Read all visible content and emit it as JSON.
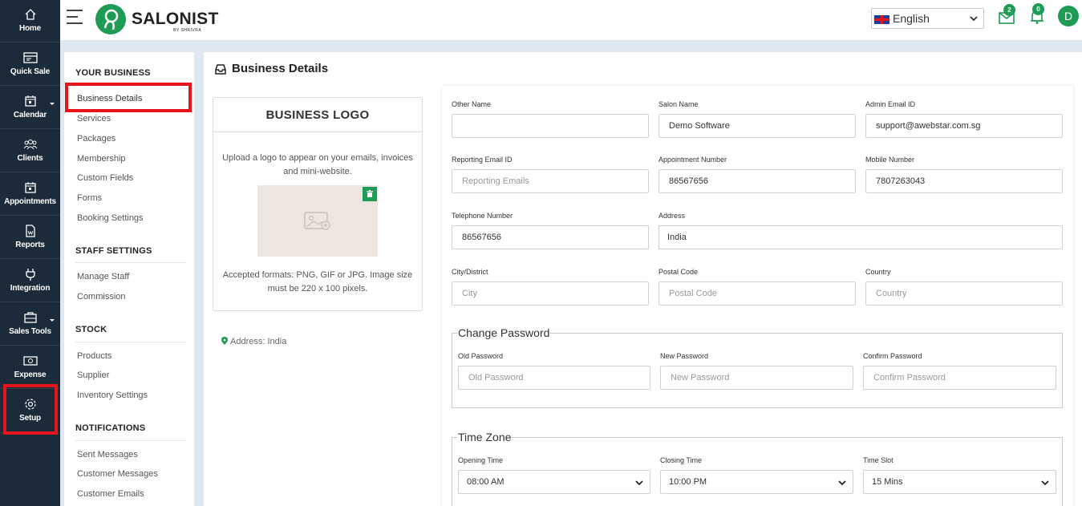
{
  "rail": {
    "items": [
      {
        "label": "Home",
        "icon": "home-icon"
      },
      {
        "label": "Quick Sale",
        "icon": "register-icon"
      },
      {
        "label": "Calendar",
        "icon": "calendar-icon"
      },
      {
        "label": "Clients",
        "icon": "users-icon"
      },
      {
        "label": "Appointments",
        "icon": "calendar-icon"
      },
      {
        "label": "Reports",
        "icon": "report-icon"
      },
      {
        "label": "Integration",
        "icon": "plug-icon"
      },
      {
        "label": "Sales Tools",
        "icon": "briefcase-icon"
      },
      {
        "label": "Expense",
        "icon": "cash-icon"
      },
      {
        "label": "Setup",
        "icon": "gear-icon"
      }
    ]
  },
  "header": {
    "brand": "SALONIST",
    "brand_sub": "BY SHRIVRA",
    "language": "English",
    "mail_count": "2",
    "notif_count": "0",
    "avatar_initial": "D"
  },
  "settings_menu": {
    "sections": [
      {
        "title": "YOUR BUSINESS",
        "items": [
          "Business Details",
          "Services",
          "Packages",
          "Membership",
          "Custom Fields",
          "Forms",
          "Booking Settings"
        ]
      },
      {
        "title": "STAFF SETTINGS",
        "items": [
          "Manage Staff",
          "Commission"
        ]
      },
      {
        "title": "STOCK",
        "items": [
          "Products",
          "Supplier",
          "Inventory Settings"
        ]
      },
      {
        "title": "NOTIFICATIONS",
        "items": [
          "Sent Messages",
          "Customer Messages",
          "Customer Emails"
        ]
      }
    ]
  },
  "main": {
    "title": "Business Details",
    "logo_card": {
      "title": "BUSINESS LOGO",
      "description": "Upload a logo to appear on your emails, invoices and mini-website.",
      "formats": "Accepted formats: PNG, GIF or JPG. Image size must be 220 x 100 pixels."
    },
    "address_line": "Address: India"
  },
  "form": {
    "other_name": {
      "label": "Other Name",
      "value": "",
      "placeholder": ""
    },
    "salon_name": {
      "label": "Salon Name",
      "value": "Demo Software"
    },
    "admin_email": {
      "label": "Admin Email ID",
      "value": "support@awebstar.com.sg"
    },
    "reporting_email": {
      "label": "Reporting Email ID",
      "placeholder": "Reporting Emails"
    },
    "appointment_number": {
      "label": "Appointment Number",
      "value": "86567656"
    },
    "mobile_number": {
      "label": "Mobile Number",
      "value": "7807263043"
    },
    "telephone_number": {
      "label": "Telephone Number",
      "value": "86567656"
    },
    "address": {
      "label": "Address",
      "value": "India"
    },
    "city": {
      "label": "City/District",
      "placeholder": "City"
    },
    "postal_code": {
      "label": "Postal Code",
      "placeholder": "Postal Code"
    },
    "country": {
      "label": "Country",
      "placeholder": "Country"
    },
    "password_section": "Change Password",
    "old_password": {
      "label": "Old Password",
      "placeholder": "Old Password"
    },
    "new_password": {
      "label": "New Password",
      "placeholder": "New Password"
    },
    "confirm_password": {
      "label": "Confirm Password",
      "placeholder": "Confirm Password"
    },
    "timezone_section": "Time Zone",
    "opening_time": {
      "label": "Opening Time",
      "value": "08:00 AM"
    },
    "closing_time": {
      "label": "Closing Time",
      "value": "10:00 PM"
    },
    "time_slot": {
      "label": "Time Slot",
      "value": "15 Mins"
    }
  },
  "colors": {
    "brand_green": "#1e9b55",
    "rail_bg": "#1c2b3a",
    "highlight_red": "#e8141c"
  }
}
